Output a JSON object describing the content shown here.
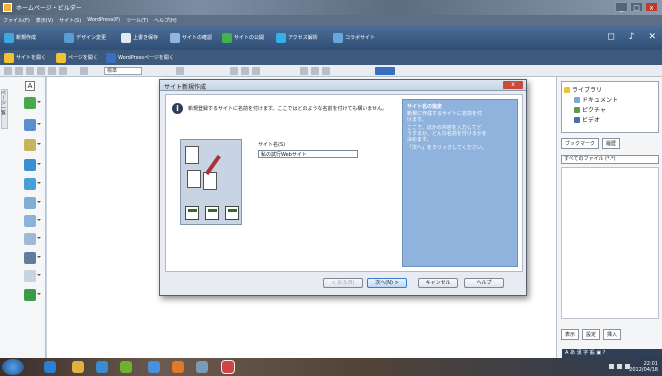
{
  "window": {
    "title": "ホームページ・ビルダー",
    "buttons": [
      "_",
      "□",
      "x"
    ]
  },
  "menu": [
    "ファイル(F)",
    "表示(V)",
    "サイト(S)",
    "WordPress(P)",
    "ツール(T)",
    "ヘルプ(H)"
  ],
  "toolbar1": {
    "items": [
      {
        "label": "新規作成",
        "color": "#3fa7e0"
      },
      {
        "label": "デザイン変更",
        "color": "#5b9bd5"
      },
      {
        "label": "上書き保存",
        "color": "#e2e8f0"
      },
      {
        "label": "サイトの確認",
        "color": "#8fb5e0"
      },
      {
        "label": "サイトの公開",
        "color": "#3db54a"
      },
      {
        "label": "アクセス解析",
        "color": "#35b0e8"
      },
      {
        "label": "コラボサイト",
        "color": "#69a6dd"
      }
    ],
    "right_icons": [
      "◻",
      "♪",
      "✕"
    ]
  },
  "toolbar2": {
    "items": [
      {
        "label": "サイトを開く",
        "color": "#f2c230"
      },
      {
        "label": "ページを開く",
        "color": "#f2c230"
      },
      {
        "label": "WordPressページを開く",
        "color": "#3a6fbf"
      }
    ]
  },
  "toolbar3": {
    "combo": "標準"
  },
  "leftpanel": {
    "vtab": "ページ一覧",
    "letter": "A"
  },
  "rightpanel": {
    "library": [
      {
        "label": "ライブラリ",
        "color": "#f2c230"
      },
      {
        "label": "ドキュメント",
        "color": "#7aa6d8"
      },
      {
        "label": "ピクチャ",
        "color": "#5a9d4a"
      },
      {
        "label": "ビデオ",
        "color": "#4a6ea8"
      }
    ],
    "tabs": [
      "ブックマーク",
      "履歴"
    ],
    "filter": "すべてのファイル (*.*)",
    "buttons": [
      "表示",
      "設定",
      "挿入"
    ]
  },
  "dialog": {
    "title": "サイト新規作成",
    "close": "x",
    "message": "新規登録するサイトに名前を付けます。ここではどのような名前を付けても構いません。",
    "field_label": "サイト名(S)",
    "field_value": "私の試行Webサイト",
    "help_title": "サイト名の指定",
    "help_p1": "新規に作成するサイトに名前を付\nけます。",
    "help_p2": "ここで、ほかの内容を入力してど\nうするか、どんな名前を付けるかを\n決めます。",
    "help_p3": "「次へ」をクリックしてください。",
    "buttons": {
      "back": "< 戻る(B)",
      "next": "次へ(N) >",
      "cancel": "キャンセル",
      "help": "ヘルプ"
    }
  },
  "langbar": "A あ 漢 字 般 ▣ ?",
  "taskbar": {
    "apps": [
      {
        "name": "IE",
        "color": "#2a7fd4"
      },
      {
        "name": "Explorer",
        "color": "#e0b040"
      },
      {
        "name": "Media",
        "color": "#3a8ad4"
      },
      {
        "name": "Builder",
        "color": "#6fb22e"
      },
      {
        "name": "Chrome",
        "color": "#4a8fe0"
      },
      {
        "name": "Firefox",
        "color": "#e07a2a"
      },
      {
        "name": "Paint",
        "color": "#7a9ab5"
      },
      {
        "name": "HPB",
        "color": "#d24444"
      }
    ],
    "time": "22:01",
    "date": "2012/04/18"
  }
}
